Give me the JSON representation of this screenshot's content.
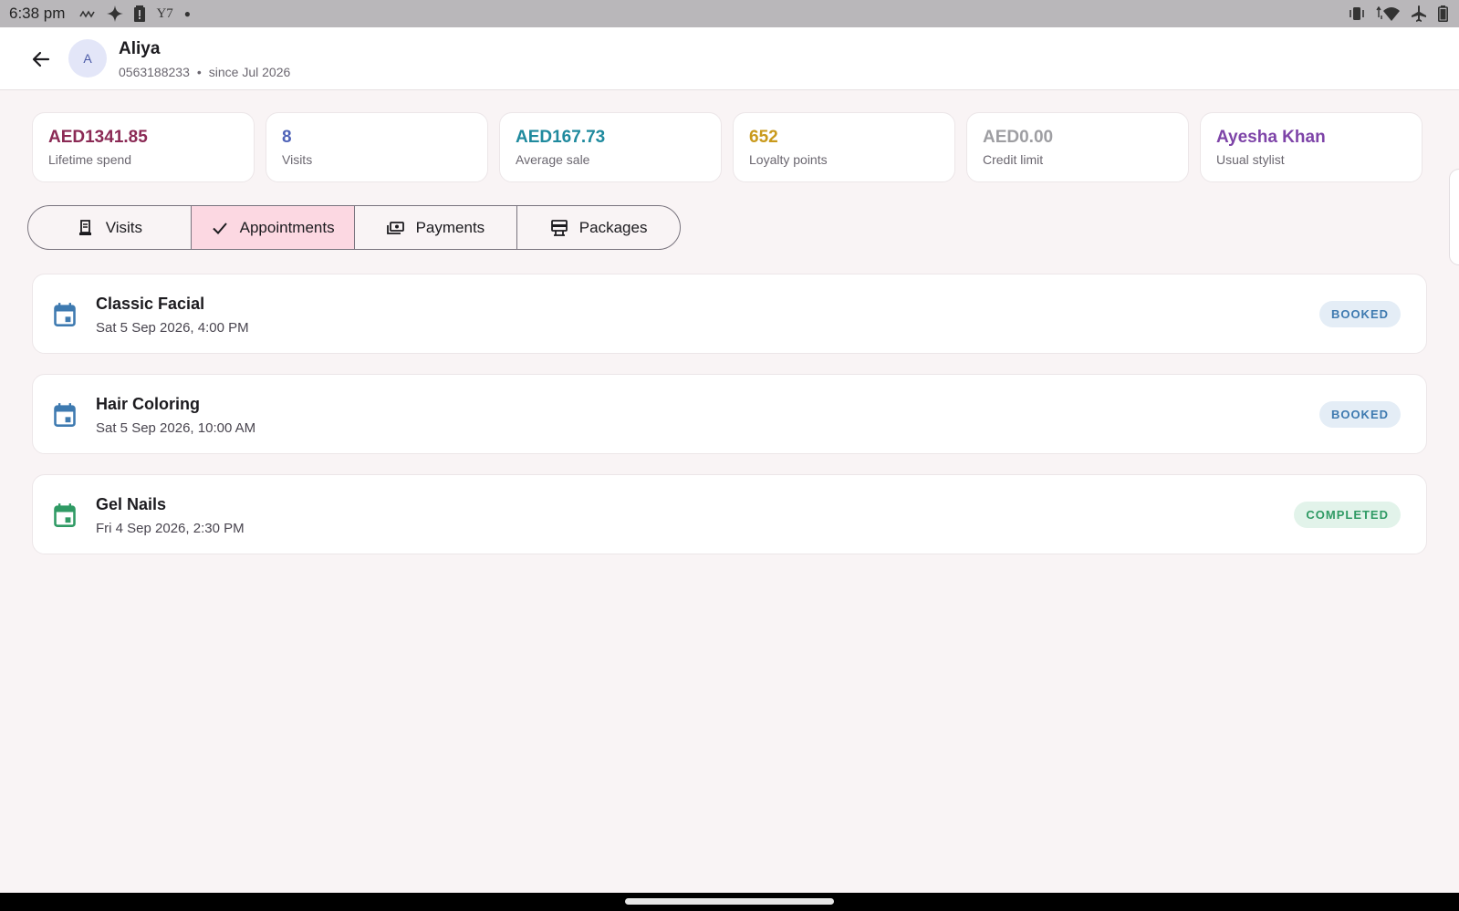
{
  "status_bar": {
    "time": "6:38 pm",
    "left_icons": [
      "signal-wave-icon",
      "sparkle-icon",
      "battery-alert-icon",
      "y7-icon",
      "dot-icon"
    ],
    "y7_text": "Y7",
    "right_icons": [
      "vibrate-icon",
      "wifi-icon",
      "airplane-icon",
      "battery-icon"
    ]
  },
  "header": {
    "avatar_initial": "A",
    "name": "Aliya",
    "phone": "0563188233",
    "separator": "•",
    "since": "since Jul 2026"
  },
  "stats": [
    {
      "value": "AED1341.85",
      "label": "Lifetime spend",
      "color": "#8b2a55"
    },
    {
      "value": "8",
      "label": "Visits",
      "color": "#4f63b8"
    },
    {
      "value": "AED167.73",
      "label": "Average sale",
      "color": "#1f8a9e"
    },
    {
      "value": "652",
      "label": "Loyalty points",
      "color": "#c99a1c"
    },
    {
      "value": "AED0.00",
      "label": "Credit limit",
      "color": "#9e9ea2"
    },
    {
      "value": "Ayesha Khan",
      "label": "Usual stylist",
      "color": "#7e44a8"
    }
  ],
  "tabs": [
    {
      "label": "Visits",
      "icon": "receipt-icon",
      "active": false
    },
    {
      "label": "Appointments",
      "icon": "check-icon",
      "active": true
    },
    {
      "label": "Payments",
      "icon": "payments-icon",
      "active": false
    },
    {
      "label": "Packages",
      "icon": "packages-icon",
      "active": false
    }
  ],
  "appointments": [
    {
      "title": "Classic Facial",
      "datetime": "Sat 5 Sep 2026, 4:00 PM",
      "status": "BOOKED",
      "icon_color": "#3e7ab0"
    },
    {
      "title": "Hair Coloring",
      "datetime": "Sat 5 Sep 2026, 10:00 AM",
      "status": "BOOKED",
      "icon_color": "#3e7ab0"
    },
    {
      "title": "Gel Nails",
      "datetime": "Fri 4 Sep 2026, 2:30 PM",
      "status": "COMPLETED",
      "icon_color": "#2f9a64"
    }
  ]
}
